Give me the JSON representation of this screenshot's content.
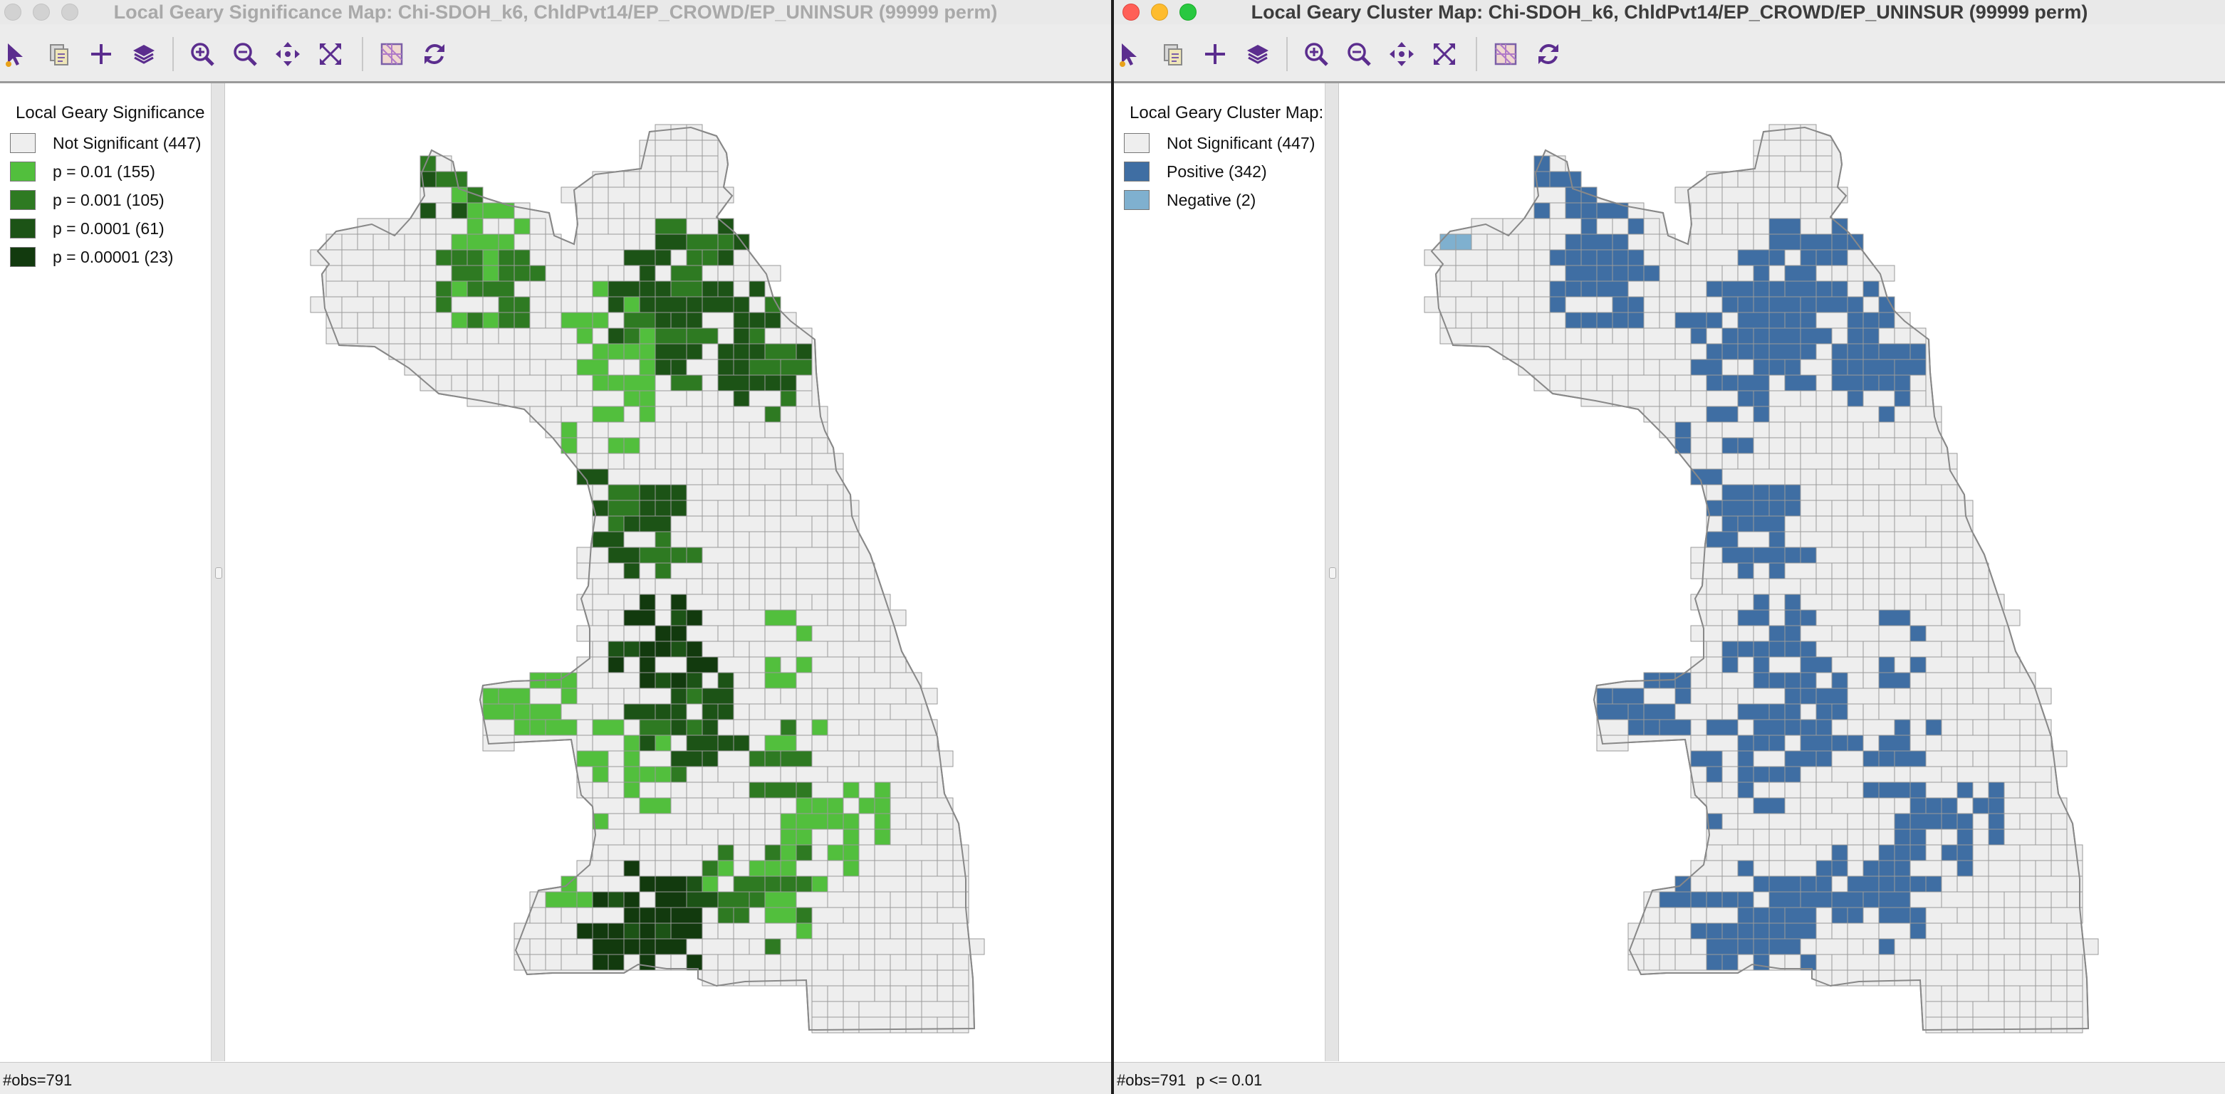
{
  "windows": [
    {
      "id": "significance",
      "title": "Local Geary Significance Map: Chi-SDOH_k6, ChldPvt14/EP_CROWD/EP_UNINSUR (99999 perm)",
      "active": false,
      "legend": {
        "title": "Local Geary Significance",
        "items": [
          {
            "label": "Not Significant (447)",
            "color": "#eeeeee"
          },
          {
            "label": "p = 0.01 (155)",
            "color": "#52bf3d"
          },
          {
            "label": "p = 0.001 (105)",
            "color": "#2e7a22"
          },
          {
            "label": "p = 0.0001 (61)",
            "color": "#1c5316"
          },
          {
            "label": "p = 0.00001 (23)",
            "color": "#123a0e"
          }
        ]
      },
      "status": {
        "obs": "#obs=791",
        "filter": ""
      }
    },
    {
      "id": "cluster",
      "title": "Local Geary Cluster Map: Chi-SDOH_k6, ChldPvt14/EP_CROWD/EP_UNINSUR (99999 perm)",
      "active": true,
      "legend": {
        "title": "Local Geary Cluster Map:",
        "items": [
          {
            "label": "Not Significant (447)",
            "color": "#eeeeee"
          },
          {
            "label": "Positive (342)",
            "color": "#3f6ea3"
          },
          {
            "label": "Negative (2)",
            "color": "#7fb0cf"
          }
        ]
      },
      "status": {
        "obs": "#obs=791",
        "filter": "p <= 0.01"
      }
    }
  ],
  "toolbar": {
    "buttons": [
      {
        "name": "select-tool",
        "icon": "arrow-pointer-icon"
      },
      {
        "name": "copy-image",
        "icon": "copy-icon"
      },
      {
        "name": "add-point",
        "icon": "plus-icon"
      },
      {
        "name": "map-layers",
        "icon": "layers-icon"
      },
      {
        "name": "zoom-in",
        "icon": "zoom-in-icon"
      },
      {
        "name": "zoom-out",
        "icon": "zoom-out-icon"
      },
      {
        "name": "pan",
        "icon": "pan-icon"
      },
      {
        "name": "fit-extent",
        "icon": "full-extent-icon"
      },
      {
        "name": "basemap",
        "icon": "basemap-icon"
      },
      {
        "name": "refresh",
        "icon": "refresh-icon"
      }
    ]
  }
}
